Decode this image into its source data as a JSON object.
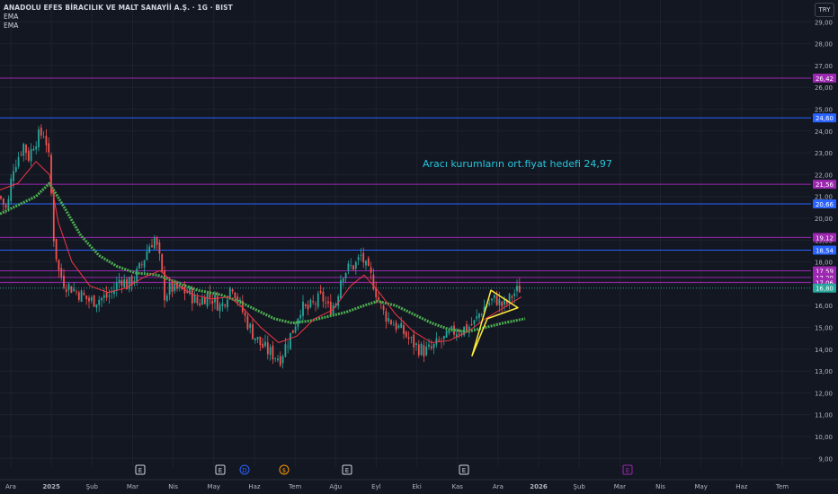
{
  "header": {
    "title": "ANADOLU EFES BİRACILIK VE MALT SANAYİİ A.Ş. · 1G · BIST",
    "indicators": [
      "EMA",
      "EMA"
    ],
    "currency": "TRY"
  },
  "annotation": "Aracı kurumların ort.fiyat hedefi 24,97",
  "colors": {
    "background": "#131722",
    "grid": "#1e222d",
    "up": "#26a69a",
    "down": "#ef5350",
    "ema_fast": "#f23645",
    "ema_slow": "#4caf50",
    "triangle": "#ffeb3b",
    "purple": "#9c27b0",
    "blue": "#2962ff",
    "annotation": "#26c6da"
  },
  "chart_data": {
    "type": "candlestick",
    "ylim": [
      8.6,
      30.0
    ],
    "y_ticks": [
      "9,00",
      "10,00",
      "11,00",
      "12,00",
      "13,00",
      "14,00",
      "15,00",
      "16,00",
      "17,00",
      "18,00",
      "19,00",
      "20,00",
      "21,00",
      "22,00",
      "23,00",
      "24,00",
      "25,00",
      "26,00",
      "27,00",
      "28,00",
      "29,00"
    ],
    "x_ticks": [
      "Ara",
      "2025",
      "Şub",
      "Mar",
      "Nis",
      "May",
      "Haz",
      "Tem",
      "Ağu",
      "Eyl",
      "Eki",
      "Kas",
      "Ara",
      "2026",
      "Şub",
      "Mar",
      "Nis",
      "May",
      "Haz",
      "Tem"
    ],
    "x_ticks_bold": [
      "2025",
      "2026"
    ],
    "horizontal_levels": [
      {
        "value": 26.42,
        "label": "26,42",
        "color": "#9c27b0"
      },
      {
        "value": 24.6,
        "label": "24,60",
        "color": "#2962ff"
      },
      {
        "value": 21.56,
        "label": "21,56",
        "color": "#9c27b0"
      },
      {
        "value": 20.66,
        "label": "20,66",
        "color": "#2962ff"
      },
      {
        "value": 19.12,
        "label": "19,12",
        "color": "#9c27b0"
      },
      {
        "value": 18.54,
        "label": "18,54",
        "color": "#2962ff"
      },
      {
        "value": 17.59,
        "label": "17,59",
        "color": "#9c27b0"
      },
      {
        "value": 17.29,
        "label": "17,29",
        "color": "#9c27b0"
      },
      {
        "value": 17.06,
        "label": "17,06",
        "color": "#9c27b0"
      }
    ],
    "last_price": {
      "value": 16.8,
      "label": "16,80",
      "color": "#26a69a"
    },
    "price_path": [
      [
        0,
        21.0
      ],
      [
        8,
        20.3
      ],
      [
        14,
        22.3
      ],
      [
        20,
        22.8
      ],
      [
        26,
        23.4
      ],
      [
        32,
        22.8
      ],
      [
        38,
        23.5
      ],
      [
        44,
        23.8
      ],
      [
        50,
        23.9
      ],
      [
        55,
        22.5
      ],
      [
        60,
        19.0
      ],
      [
        65,
        17.6
      ],
      [
        72,
        17.0
      ],
      [
        80,
        16.8
      ],
      [
        90,
        16.5
      ],
      [
        100,
        16.2
      ],
      [
        110,
        16.3
      ],
      [
        120,
        16.4
      ],
      [
        128,
        16.8
      ],
      [
        134,
        17.3
      ],
      [
        142,
        16.9
      ],
      [
        150,
        17.3
      ],
      [
        158,
        17.9
      ],
      [
        165,
        18.7
      ],
      [
        172,
        19.1
      ],
      [
        178,
        18.0
      ],
      [
        183,
        16.5
      ],
      [
        190,
        16.8
      ],
      [
        200,
        16.7
      ],
      [
        210,
        16.6
      ],
      [
        220,
        16.1
      ],
      [
        230,
        16.5
      ],
      [
        240,
        16.2
      ],
      [
        246,
        15.9
      ],
      [
        252,
        16.5
      ],
      [
        258,
        17.0
      ],
      [
        264,
        16.3
      ],
      [
        272,
        15.5
      ],
      [
        280,
        14.8
      ],
      [
        290,
        14.2
      ],
      [
        298,
        13.9
      ],
      [
        306,
        13.7
      ],
      [
        312,
        13.6
      ],
      [
        318,
        14.2
      ],
      [
        326,
        14.9
      ],
      [
        334,
        15.9
      ],
      [
        342,
        15.8
      ],
      [
        350,
        16.1
      ],
      [
        358,
        16.4
      ],
      [
        366,
        15.8
      ],
      [
        374,
        16.2
      ],
      [
        380,
        17.5
      ],
      [
        388,
        17.7
      ],
      [
        396,
        17.9
      ],
      [
        402,
        18.3
      ],
      [
        408,
        17.6
      ],
      [
        414,
        17.2
      ],
      [
        420,
        16.4
      ],
      [
        426,
        15.7
      ],
      [
        432,
        15.4
      ],
      [
        440,
        15.1
      ],
      [
        448,
        14.8
      ],
      [
        456,
        14.4
      ],
      [
        464,
        14.1
      ],
      [
        472,
        13.9
      ],
      [
        480,
        14.0
      ],
      [
        488,
        14.3
      ],
      [
        496,
        14.5
      ],
      [
        504,
        14.8
      ],
      [
        512,
        14.9
      ],
      [
        520,
        15.0
      ],
      [
        528,
        15.2
      ],
      [
        534,
        15.7
      ],
      [
        540,
        16.0
      ],
      [
        546,
        16.2
      ],
      [
        552,
        16.3
      ],
      [
        558,
        16.0
      ],
      [
        564,
        16.1
      ],
      [
        570,
        16.5
      ],
      [
        576,
        16.7
      ],
      [
        580,
        16.9
      ]
    ],
    "ema_fast_path": [
      [
        0,
        21.3
      ],
      [
        20,
        21.6
      ],
      [
        40,
        22.6
      ],
      [
        55,
        22.0
      ],
      [
        65,
        19.8
      ],
      [
        80,
        18.0
      ],
      [
        100,
        16.9
      ],
      [
        120,
        16.6
      ],
      [
        140,
        16.8
      ],
      [
        160,
        17.3
      ],
      [
        178,
        17.6
      ],
      [
        195,
        17.0
      ],
      [
        215,
        16.5
      ],
      [
        235,
        16.3
      ],
      [
        255,
        16.4
      ],
      [
        270,
        15.9
      ],
      [
        290,
        15.0
      ],
      [
        310,
        14.3
      ],
      [
        330,
        14.6
      ],
      [
        350,
        15.4
      ],
      [
        370,
        15.8
      ],
      [
        390,
        16.9
      ],
      [
        405,
        17.4
      ],
      [
        420,
        16.7
      ],
      [
        440,
        15.6
      ],
      [
        460,
        14.8
      ],
      [
        480,
        14.3
      ],
      [
        500,
        14.4
      ],
      [
        520,
        14.8
      ],
      [
        540,
        15.4
      ],
      [
        560,
        15.9
      ],
      [
        580,
        16.4
      ]
    ],
    "ema_slow_path": [
      [
        0,
        20.2
      ],
      [
        20,
        20.6
      ],
      [
        40,
        21.0
      ],
      [
        55,
        21.6
      ],
      [
        70,
        20.6
      ],
      [
        90,
        19.2
      ],
      [
        110,
        18.3
      ],
      [
        130,
        17.8
      ],
      [
        150,
        17.5
      ],
      [
        175,
        17.4
      ],
      [
        200,
        17.0
      ],
      [
        220,
        16.7
      ],
      [
        245,
        16.5
      ],
      [
        265,
        16.2
      ],
      [
        285,
        15.8
      ],
      [
        305,
        15.4
      ],
      [
        325,
        15.2
      ],
      [
        345,
        15.3
      ],
      [
        365,
        15.5
      ],
      [
        385,
        15.7
      ],
      [
        405,
        16.0
      ],
      [
        420,
        16.2
      ],
      [
        440,
        16.0
      ],
      [
        460,
        15.6
      ],
      [
        480,
        15.2
      ],
      [
        500,
        14.9
      ],
      [
        520,
        14.8
      ],
      [
        540,
        15.0
      ],
      [
        560,
        15.2
      ],
      [
        584,
        15.4
      ]
    ],
    "triangle": [
      [
        525,
        13.7
      ],
      [
        546,
        16.7
      ],
      [
        576,
        15.9
      ],
      [
        542,
        15.4
      ]
    ],
    "event_markers": [
      {
        "x": 156,
        "label": "E",
        "color": "#d1d4dc"
      },
      {
        "x": 245,
        "label": "E",
        "color": "#d1d4dc"
      },
      {
        "x": 272,
        "label": "D",
        "color": "#2962ff",
        "round": true
      },
      {
        "x": 316,
        "label": "$",
        "color": "#ff9800",
        "round": true
      },
      {
        "x": 386,
        "label": "E",
        "color": "#d1d4dc"
      },
      {
        "x": 516,
        "label": "E",
        "color": "#d1d4dc"
      },
      {
        "x": 698,
        "label": "E",
        "color": "#9c27b0"
      }
    ]
  }
}
